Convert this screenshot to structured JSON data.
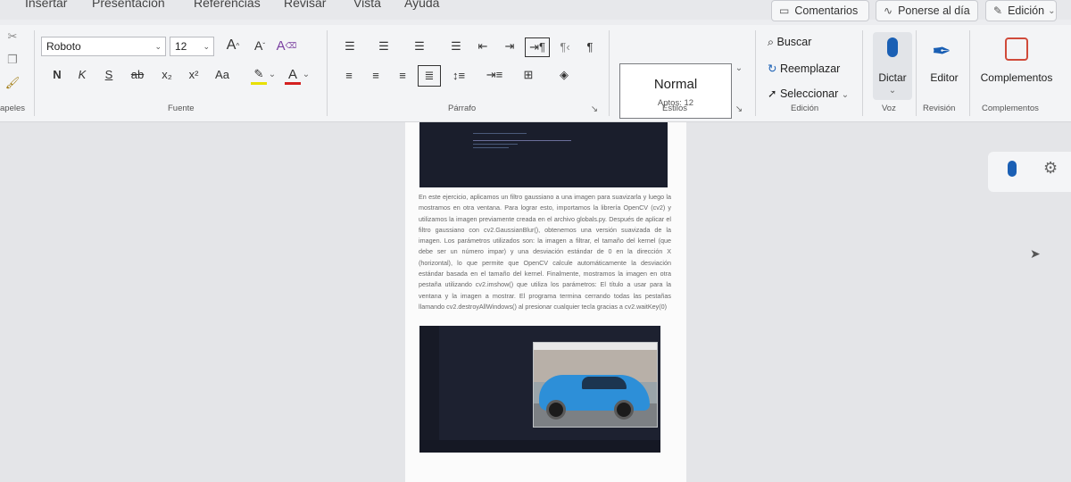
{
  "tabs": [
    "Insertar",
    "Presentación",
    "Referencias",
    "Revisar",
    "Vista",
    "Ayuda"
  ],
  "top_buttons": {
    "comments": "Comentarios",
    "catch_up": "Ponerse al día",
    "editing": "Edición"
  },
  "font": {
    "name": "Roboto",
    "size": "12",
    "group_label": "Fuente",
    "buttons": [
      "N",
      "K",
      "S",
      "ab",
      "x₂",
      "x²",
      "Aa"
    ]
  },
  "clipboard": {
    "group_label": "apeles"
  },
  "paragraph": {
    "group_label": "Párrafo"
  },
  "styles": {
    "name": "Normal",
    "sub": "Aptos: 12",
    "group_label": "Estilos"
  },
  "editing": {
    "find": "Buscar",
    "replace": "Reemplazar",
    "select": "Seleccionar",
    "group_label": "Edición"
  },
  "voice": {
    "dictate": "Dictar",
    "group_label": "Voz"
  },
  "review": {
    "editor": "Editor",
    "group_label": "Revisión"
  },
  "addins": {
    "label": "Complementos",
    "group_label": "Complementos"
  },
  "document": {
    "paragraph": "En este ejercicio, aplicamos un filtro gaussiano a una imagen para suavizarla y luego la mostramos en otra ventana. Para lograr esto, importamos la librería OpenCV (cv2) y utilizamos la imagen previamente creada en el archivo globals.py. Después de aplicar el filtro gaussiano con cv2.GaussianBlur(), obtenemos una versión suavizada de la imagen. Los parámetros utilizados son: la imagen a filtrar, el tamaño del kernel (que debe ser un número impar) y una desviación estándar de 0 en la dirección X (horizontal), lo que permite que OpenCV calcule automáticamente la desviación estándar basada en el tamaño del kernel. Finalmente, mostramos la imagen en otra pestaña utilizando cv2.imshow() que utiliza los parámetros: El título a usar para la ventana y la imagen a mostrar. El programa termina cerrando todas las pestañas llamando cv2.destroyAllWindows() al presionar cualquier tecla gracias a cv2.waitKey(0)"
  },
  "colors": {
    "accent": "#1a5fb4",
    "highlight": "#e8e000",
    "font_color": "#d42020"
  }
}
